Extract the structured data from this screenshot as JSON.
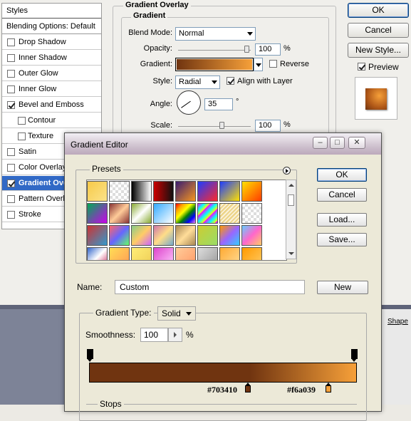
{
  "layer_style": {
    "styles_header": "Styles",
    "blending_options": "Blending Options: Default",
    "styles": [
      {
        "label": "Drop Shadow",
        "checked": false,
        "indent": false,
        "selected": false
      },
      {
        "label": "Inner Shadow",
        "checked": false,
        "indent": false,
        "selected": false
      },
      {
        "label": "Outer Glow",
        "checked": false,
        "indent": false,
        "selected": false
      },
      {
        "label": "Inner Glow",
        "checked": false,
        "indent": false,
        "selected": false
      },
      {
        "label": "Bevel and Emboss",
        "checked": true,
        "indent": false,
        "selected": false
      },
      {
        "label": "Contour",
        "checked": false,
        "indent": true,
        "selected": false
      },
      {
        "label": "Texture",
        "checked": false,
        "indent": true,
        "selected": false
      },
      {
        "label": "Satin",
        "checked": false,
        "indent": false,
        "selected": false
      },
      {
        "label": "Color Overlay",
        "checked": false,
        "indent": false,
        "selected": false
      },
      {
        "label": "Gradient Overlay",
        "checked": true,
        "indent": false,
        "selected": true
      },
      {
        "label": "Pattern Overlay",
        "checked": false,
        "indent": false,
        "selected": false
      },
      {
        "label": "Stroke",
        "checked": false,
        "indent": false,
        "selected": false
      }
    ],
    "panel_title": "Gradient Overlay",
    "section_title": "Gradient",
    "blend_mode_label": "Blend Mode:",
    "blend_mode_value": "Normal",
    "opacity_label": "Opacity:",
    "opacity_value": "100",
    "percent": "%",
    "gradient_label": "Gradient:",
    "reverse_label": "Reverse",
    "style_label": "Style:",
    "style_value": "Radial",
    "align_label": "Align with Layer",
    "angle_label": "Angle:",
    "angle_value": "35",
    "degree": "°",
    "scale_label": "Scale:",
    "scale_value": "100",
    "ok_label": "OK",
    "cancel_label": "Cancel",
    "new_style_label": "New Style...",
    "preview_label": "Preview",
    "right_edge_label": "Shape"
  },
  "gradient_editor": {
    "title": "Gradient Editor",
    "presets_label": "Presets",
    "ok_label": "OK",
    "cancel_label": "Cancel",
    "load_label": "Load...",
    "save_label": "Save...",
    "name_label": "Name:",
    "name_value": "Custom",
    "new_label": "New",
    "gradient_type_label": "Gradient Type:",
    "gradient_type_value": "Solid",
    "smoothness_label": "Smoothness:",
    "smoothness_value": "100",
    "percent": "%",
    "stop1_label": "#703410",
    "stop2_label": "#f6a039",
    "stops_label": "Stops",
    "gradient_colors": {
      "start": "#703410",
      "end": "#f6a039"
    }
  }
}
